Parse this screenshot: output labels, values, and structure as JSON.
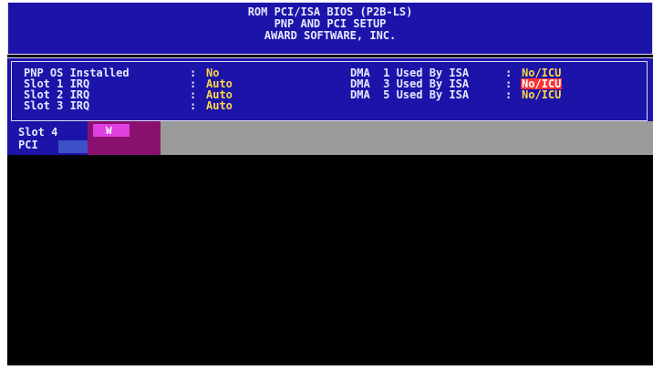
{
  "header": {
    "line1": "ROM PCI/ISA BIOS (P2B-LS)",
    "line2": "PNP AND PCI SETUP",
    "line3": "AWARD SOFTWARE, INC."
  },
  "left_items": [
    {
      "label": "PNP OS Installed",
      "value": "No"
    },
    {
      "label": "Slot 1 IRQ",
      "value": "Auto"
    },
    {
      "label": "Slot 2 IRQ",
      "value": "Auto"
    },
    {
      "label": "Slot 3 IRQ",
      "value": "Auto"
    }
  ],
  "partial_items": [
    {
      "label": "Slot 4"
    },
    {
      "label": "PCI"
    }
  ],
  "right_items": [
    {
      "label": "DMA  1 Used By ISA",
      "value": "No/ICU",
      "selected": false
    },
    {
      "label": "DMA  3 Used By ISA",
      "value": "No/ICU",
      "selected": true
    },
    {
      "label": "DMA  5 Used By ISA",
      "value": "No/ICU",
      "selected": false
    }
  ],
  "colon": ":",
  "glitch_text": "W",
  "colors": {
    "bios_blue": "#1c14a8",
    "value_yellow": "#ffd84a",
    "highlight_red": "#ff3030",
    "overlay_grey": "#9a9a9a",
    "glitch_magenta": "#8a1070"
  }
}
